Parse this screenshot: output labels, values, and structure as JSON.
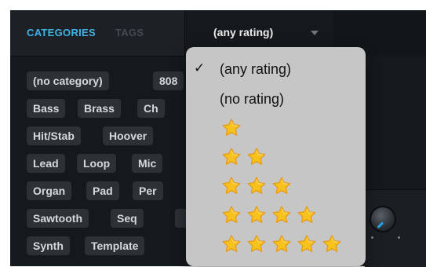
{
  "tabs": {
    "categories": "CATEGORIES",
    "tags": "TAGS"
  },
  "rating_select": {
    "value": "(any rating)",
    "caret_icon": "caret-down-icon"
  },
  "chips": [
    "(no category)",
    "808",
    "Bass",
    "Brass",
    "Ch",
    "Hit/Stab",
    "Hoover",
    "Lead",
    "Loop",
    "Mic",
    "Organ",
    "Pad",
    "Per",
    "Sawtooth",
    "Seq",
    "Synth",
    "Template"
  ],
  "dropdown": {
    "checkmark": "✓",
    "options": [
      {
        "label": "(any rating)",
        "selected": true
      },
      {
        "label": "(no rating)",
        "selected": false
      },
      {
        "stars": 1
      },
      {
        "stars": 2
      },
      {
        "stars": 3
      },
      {
        "stars": 4
      },
      {
        "stars": 5
      }
    ]
  },
  "colors": {
    "accent": "#3fb3e6",
    "star_fill": "#f7c21d",
    "star_edge": "#e79a10",
    "menu_bg": "#c6c6c6"
  }
}
